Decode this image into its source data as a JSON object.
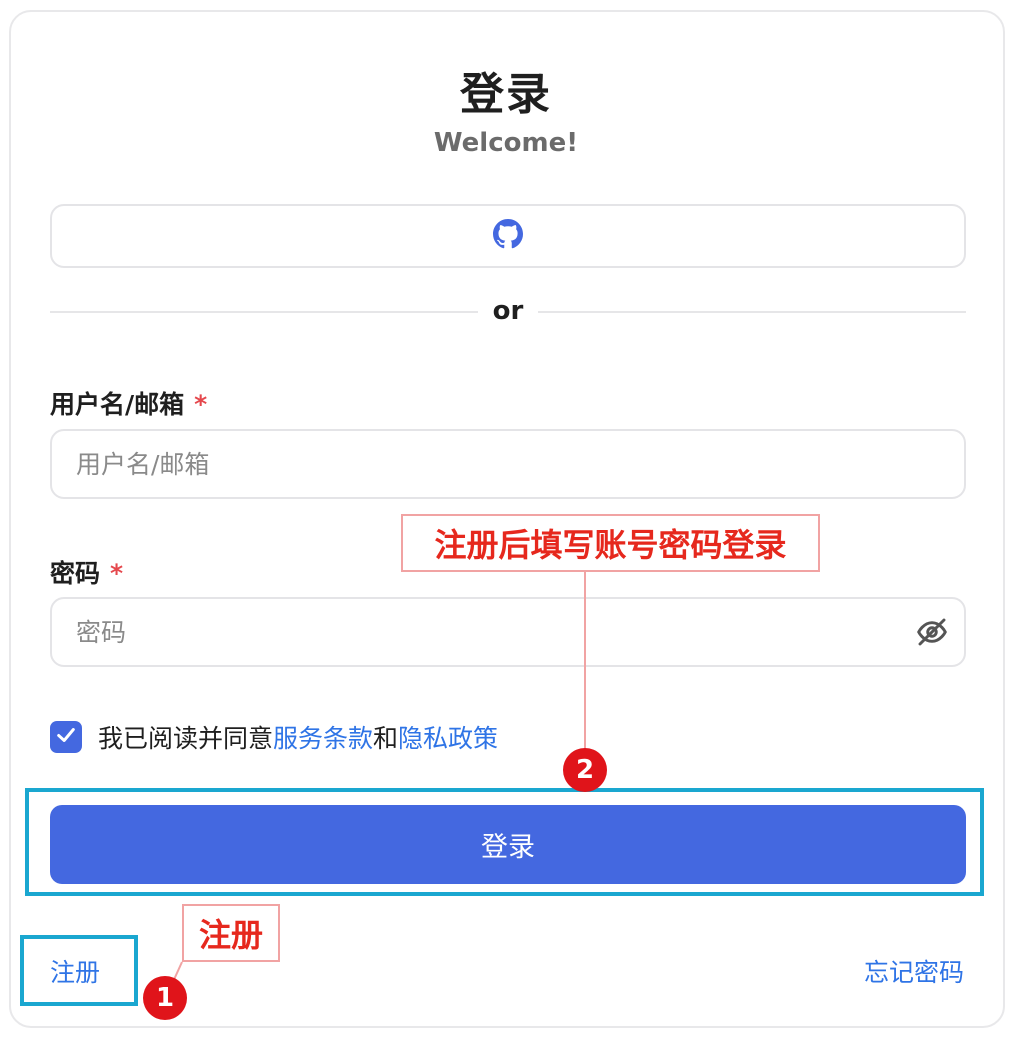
{
  "header": {
    "title": "登录",
    "subtitle": "Welcome!"
  },
  "oauth": {
    "provider_icon": "github-icon",
    "accent": "#4468e0"
  },
  "divider": {
    "text": "or"
  },
  "form": {
    "username": {
      "label": "用户名/邮箱",
      "required_mark": "*",
      "placeholder": "用户名/邮箱",
      "value": ""
    },
    "password": {
      "label": "密码",
      "required_mark": "*",
      "placeholder": "密码",
      "value": "",
      "toggle_icon": "eye-off-icon"
    },
    "agreement": {
      "checked": true,
      "prefix": "我已阅读并同意",
      "terms_link": "服务条款",
      "conjunction": "和",
      "privacy_link": "隐私政策"
    },
    "submit_label": "登录"
  },
  "footer": {
    "register_label": "注册",
    "forgot_label": "忘记密码"
  },
  "annotations": {
    "step1": {
      "badge": "1",
      "callout": "注册"
    },
    "step2": {
      "badge": "2",
      "callout": "注册后填写账号密码登录"
    },
    "colors": {
      "highlight_box": "#1aa7d0",
      "callout_text": "#e6281d",
      "callout_border": "#f1a3a3",
      "badge": "#e0141a"
    }
  }
}
